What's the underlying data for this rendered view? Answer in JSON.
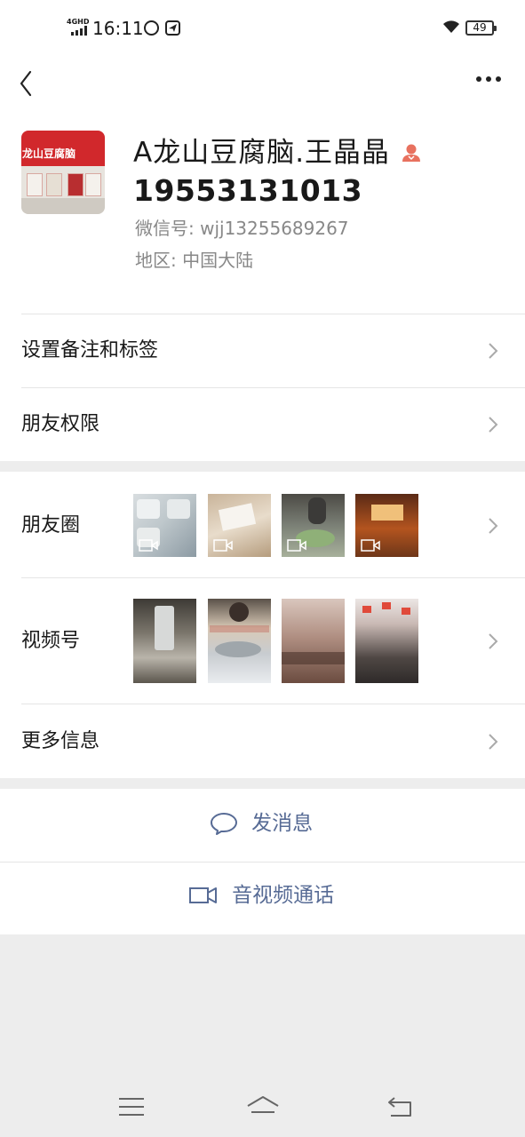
{
  "status_bar": {
    "network": "4GHD",
    "time": "16:11",
    "battery": "49",
    "icons": [
      "signal-icon",
      "vpn-icon",
      "telegram-icon",
      "wifi-icon",
      "battery-icon"
    ]
  },
  "nav": {
    "back_icon": "chevron-left-icon",
    "more_icon": "more-dots-icon"
  },
  "profile": {
    "name": "A龙山豆腐脑.王晶晶",
    "phone": "19553131013",
    "wechat_id": "微信号: wjj13255689267",
    "region": "地区: 中国大陆",
    "avatar_sign": "龙山豆腐脑",
    "gender_icon": "female-user-icon"
  },
  "menu": {
    "remark": "设置备注和标签",
    "permissions": "朋友权限",
    "moments": "朋友圈",
    "channels": "视频号",
    "more_info": "更多信息"
  },
  "actions": {
    "message": "发消息",
    "call": "音视频通话"
  },
  "system_nav": [
    "menu-icon",
    "home-icon",
    "back-icon"
  ],
  "colors": {
    "link": "#576b95",
    "background": "#ededed",
    "gender_icon": "#e8715f"
  }
}
